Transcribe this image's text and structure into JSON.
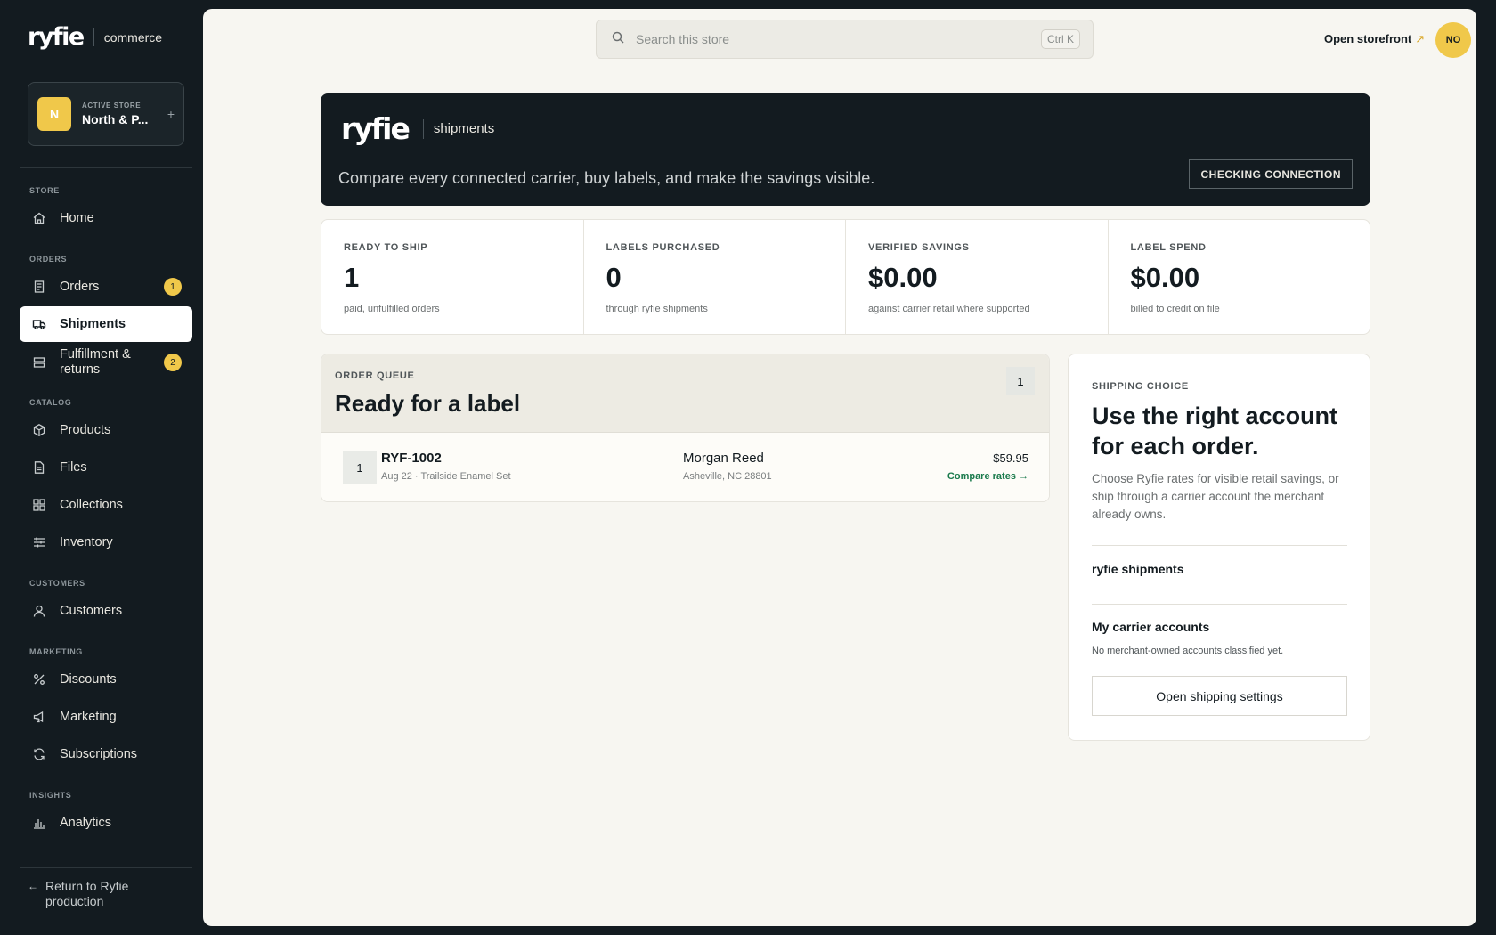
{
  "brand": {
    "logo": "ryfie",
    "product": "commerce"
  },
  "store": {
    "avatar_letter": "N",
    "label": "ACTIVE STORE",
    "name": "North & P...",
    "add_symbol": "+"
  },
  "sidebar": {
    "sections": {
      "store": "STORE",
      "orders": "ORDERS",
      "catalog": "CATALOG",
      "customers": "CUSTOMERS",
      "marketing": "MARKETING",
      "insights": "INSIGHTS"
    },
    "items": [
      {
        "label": "Home",
        "icon": "home-icon"
      },
      {
        "label": "Orders",
        "icon": "receipt-icon",
        "badge": "1"
      },
      {
        "label": "Shipments",
        "icon": "truck-icon",
        "active": true
      },
      {
        "label": "Fulfillment & returns",
        "icon": "box-stack-icon",
        "badge": "2"
      },
      {
        "label": "Products",
        "icon": "cube-icon"
      },
      {
        "label": "Files",
        "icon": "file-icon"
      },
      {
        "label": "Collections",
        "icon": "grid-icon"
      },
      {
        "label": "Inventory",
        "icon": "sliders-icon"
      },
      {
        "label": "Customers",
        "icon": "user-icon"
      },
      {
        "label": "Discounts",
        "icon": "percent-icon"
      },
      {
        "label": "Marketing",
        "icon": "megaphone-icon"
      },
      {
        "label": "Subscriptions",
        "icon": "refresh-icon"
      },
      {
        "label": "Analytics",
        "icon": "bar-chart-icon"
      }
    ],
    "return_arrow": "←",
    "return_label": "Return to Ryfie production"
  },
  "topbar": {
    "search_placeholder": "Search this store",
    "search_shortcut": "Ctrl K",
    "open_storefront": "Open storefront",
    "open_storefront_icon": "↗",
    "user_initials": "NO"
  },
  "hero": {
    "logo": "ryfie",
    "product": "shipments",
    "tagline": "Compare every connected carrier, buy labels, and make the savings visible.",
    "status_button": "CHECKING CONNECTION"
  },
  "stats": [
    {
      "label": "READY TO SHIP",
      "value": "1",
      "sub": "paid, unfulfilled orders"
    },
    {
      "label": "LABELS PURCHASED",
      "value": "0",
      "sub": "through ryfie shipments"
    },
    {
      "label": "VERIFIED SAVINGS",
      "value": "$0.00",
      "sub": "against carrier retail where supported"
    },
    {
      "label": "LABEL SPEND",
      "value": "$0.00",
      "sub": "billed to credit on file"
    }
  ],
  "queue": {
    "label": "ORDER QUEUE",
    "title": "Ready for a label",
    "count": "1",
    "orders": [
      {
        "index": "1",
        "id": "RYF-1002",
        "meta": "Aug 22 · Trailside Enamel Set",
        "customer": "Morgan Reed",
        "location": "Asheville, NC 28801",
        "total": "$59.95",
        "action": "Compare rates →"
      }
    ]
  },
  "choice": {
    "label": "SHIPPING CHOICE",
    "title": "Use the right account for each order.",
    "description": "Choose Ryfie rates for visible retail savings, or ship through a carrier account the merchant already owns.",
    "option_ryfie": "ryfie shipments",
    "option_carrier": "My carrier accounts",
    "option_carrier_note": "No merchant-owned accounts classified yet.",
    "settings_button": "Open shipping settings"
  },
  "colors": {
    "accent": "#f0c84a",
    "sidebar_bg": "#131b20",
    "main_bg": "#f7f6f1",
    "link_green": "#1a7a4c"
  }
}
